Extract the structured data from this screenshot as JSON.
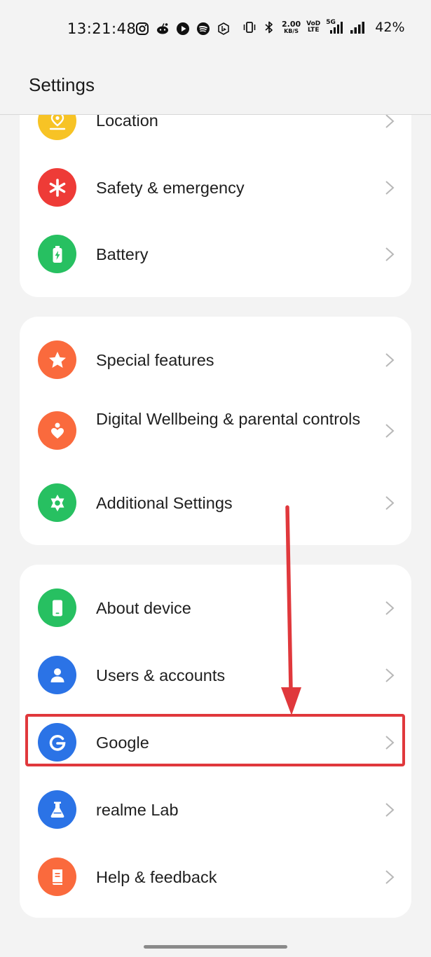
{
  "status_bar": {
    "time": "13:21:48",
    "speed_value": "2.00",
    "speed_unit": "KB/S",
    "volte_top": "VoD",
    "volte_bottom": "LTE",
    "network": "5G",
    "battery_percent": "42%",
    "icons": [
      "instagram-icon",
      "reddit-icon",
      "youtube-icon",
      "spotify-icon",
      "bing-icon",
      "vibrate-icon",
      "bluetooth-icon",
      "signal-icon"
    ]
  },
  "header": {
    "title": "Settings"
  },
  "groups": [
    {
      "items": [
        {
          "label": "Location",
          "icon": "location-icon",
          "color": "#f7c325"
        },
        {
          "label": "Safety & emergency",
          "icon": "asterisk-icon",
          "color": "#ee3b37"
        },
        {
          "label": "Battery",
          "icon": "battery-icon",
          "color": "#27c061"
        }
      ]
    },
    {
      "items": [
        {
          "label": "Special features",
          "icon": "star-icon",
          "color": "#fa6a3d"
        },
        {
          "label": "Digital Wellbeing & parental controls",
          "icon": "wellbeing-icon",
          "color": "#fa6a3d"
        },
        {
          "label": "Additional Settings",
          "icon": "gear-icon",
          "color": "#27c061"
        }
      ]
    },
    {
      "items": [
        {
          "label": "About device",
          "icon": "phone-icon",
          "color": "#27c061"
        },
        {
          "label": "Users & accounts",
          "icon": "person-icon",
          "color": "#2b73e6"
        },
        {
          "label": "Google",
          "icon": "google-icon",
          "color": "#2b73e6"
        },
        {
          "label": "realme Lab",
          "icon": "flask-icon",
          "color": "#2b73e6"
        },
        {
          "label": "Help & feedback",
          "icon": "book-icon",
          "color": "#fa6a3d"
        }
      ]
    }
  ],
  "annotation": {
    "color": "#e0383c"
  }
}
